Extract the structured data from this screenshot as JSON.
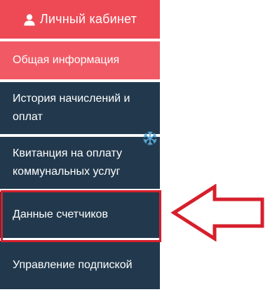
{
  "menu": {
    "header_label": "Личный кабинет",
    "header_icon": "user-icon",
    "items": [
      {
        "label": "Общая информация",
        "active": true
      },
      {
        "label": "История начислений и оплат",
        "active": false
      },
      {
        "label": "Квитанция на оплату коммунальных услуг",
        "active": false
      },
      {
        "label": "Данные счетчиков",
        "active": false,
        "highlighted": true
      },
      {
        "label": "Управление подпиской",
        "active": false
      }
    ]
  },
  "annotations": {
    "highlight_icon": "highlight-box",
    "arrow_icon": "left-arrow-icon",
    "decoration_icon": "snowflake-icon"
  },
  "colors": {
    "header_bg": "#ee4a55",
    "active_bg": "#f15a65",
    "item_bg": "#22394d",
    "highlight": "#d61f2c",
    "snowflake": "#5aa9d8"
  }
}
